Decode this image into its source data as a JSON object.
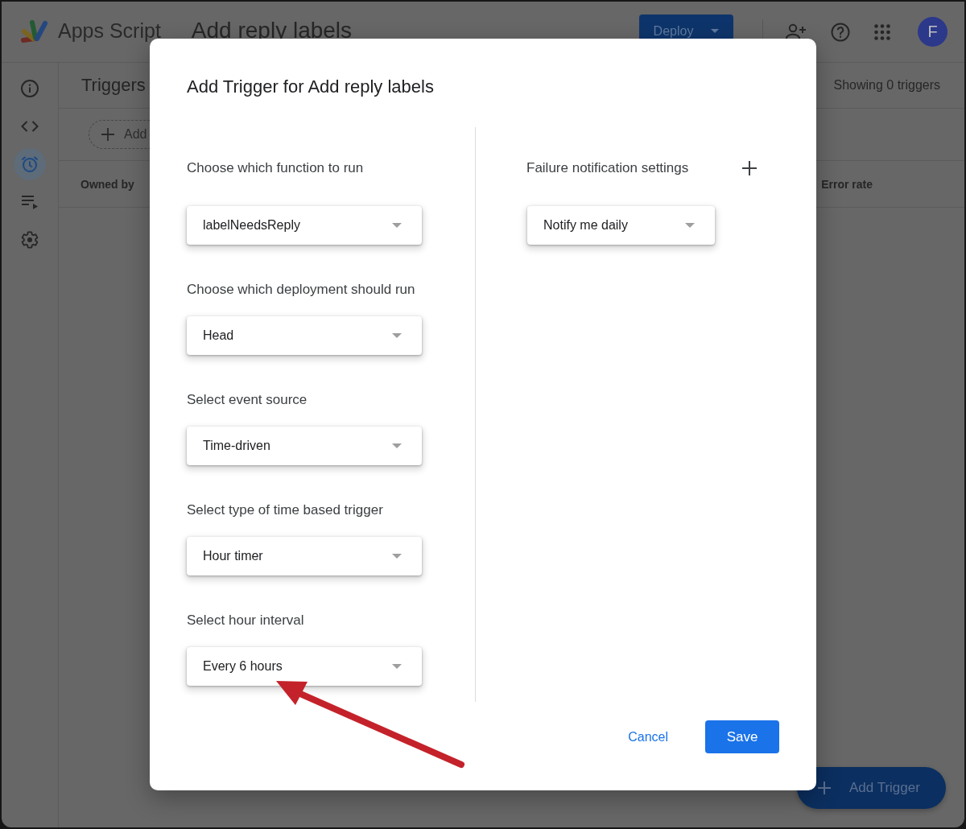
{
  "app_bar": {
    "product": "Apps Script",
    "project_title": "Add reply labels",
    "deploy_button": "Deploy",
    "avatar_initial": "F"
  },
  "nav_rail": [
    {
      "selected": false
    },
    {
      "selected": false
    },
    {
      "selected": true
    },
    {
      "selected": false
    },
    {
      "selected": false
    }
  ],
  "triggers_page": {
    "title": "Triggers",
    "count": "Showing 0 triggers",
    "add_button": "Add",
    "columns": [
      "Owned by",
      "Error rate"
    ],
    "fab": "Add Trigger"
  },
  "dialog": {
    "title": "Add Trigger for Add reply labels",
    "fields": [
      {
        "label": "Choose which function to run",
        "value": "labelNeedsReply"
      },
      {
        "label": "Choose which deployment should run",
        "value": "Head"
      },
      {
        "label": "Select event source",
        "value": "Time-driven"
      },
      {
        "label": "Select type of time based trigger",
        "value": "Hour timer"
      },
      {
        "label": "Select hour interval",
        "value": "Every 6 hours"
      }
    ],
    "notification": {
      "label": "Failure notification settings",
      "value": "Notify me daily"
    },
    "buttons": [
      {
        "label": "Cancel",
        "kind": "text"
      },
      {
        "label": "Save",
        "kind": "primary"
      }
    ]
  },
  "annotations": [
    {
      "kind": "arrow"
    }
  ]
}
